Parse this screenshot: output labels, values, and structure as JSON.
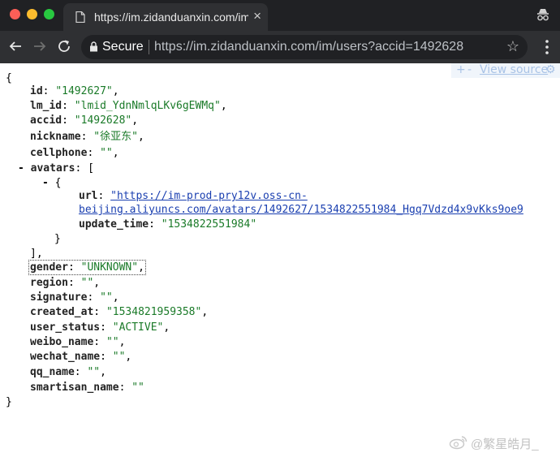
{
  "browser": {
    "tab_title": "https://im.zidanduanxin.com/im",
    "tab_close": "×",
    "secure_label": "Secure",
    "url": "https://im.zidanduanxin.com/im/users?accid=1492628",
    "star": "☆"
  },
  "viewer": {
    "plus": "+",
    "minus": "-",
    "view_source": "View source",
    "gear": "⚙"
  },
  "json": {
    "open_brace": "{",
    "close_brace": "}",
    "fields": {
      "id": {
        "key": "id",
        "value": "\"1492627\""
      },
      "lm_id": {
        "key": "lm_id",
        "value": "\"lmid_YdnNmlqLKv6gEWMq\""
      },
      "accid": {
        "key": "accid",
        "value": "\"1492628\""
      },
      "nickname": {
        "key": "nickname",
        "value": "\"徐亚东\""
      },
      "cellphone": {
        "key": "cellphone",
        "value": "\"\""
      },
      "avatars": {
        "key": "avatars",
        "fold": "-",
        "open": "[",
        "item_fold": "-",
        "item_open": "{",
        "item_close": "}",
        "close": "],"
      },
      "url": {
        "key": "url",
        "value_line1": "\"https://im-prod-pry12v.oss-cn-",
        "value_line2": "beijing.aliyuncs.com/avatars/1492627/1534822551984_Hgq7Vdzd4x9vKks9oe9"
      },
      "update_time": {
        "key": "update_time",
        "value": "\"1534822551984\""
      },
      "gender": {
        "key": "gender",
        "value": "\"UNKNOWN\""
      },
      "region": {
        "key": "region",
        "value": "\"\""
      },
      "signature": {
        "key": "signature",
        "value": "\"\""
      },
      "created_at": {
        "key": "created_at",
        "value": "\"1534821959358\""
      },
      "user_status": {
        "key": "user_status",
        "value": "\"ACTIVE\""
      },
      "weibo_name": {
        "key": "weibo_name",
        "value": "\"\""
      },
      "wechat_name": {
        "key": "wechat_name",
        "value": "\"\""
      },
      "qq_name": {
        "key": "qq_name",
        "value": "\"\""
      },
      "smartisan_name": {
        "key": "smartisan_name",
        "value": "\"\""
      }
    }
  },
  "watermark": {
    "text": "@繁星皓月_"
  }
}
